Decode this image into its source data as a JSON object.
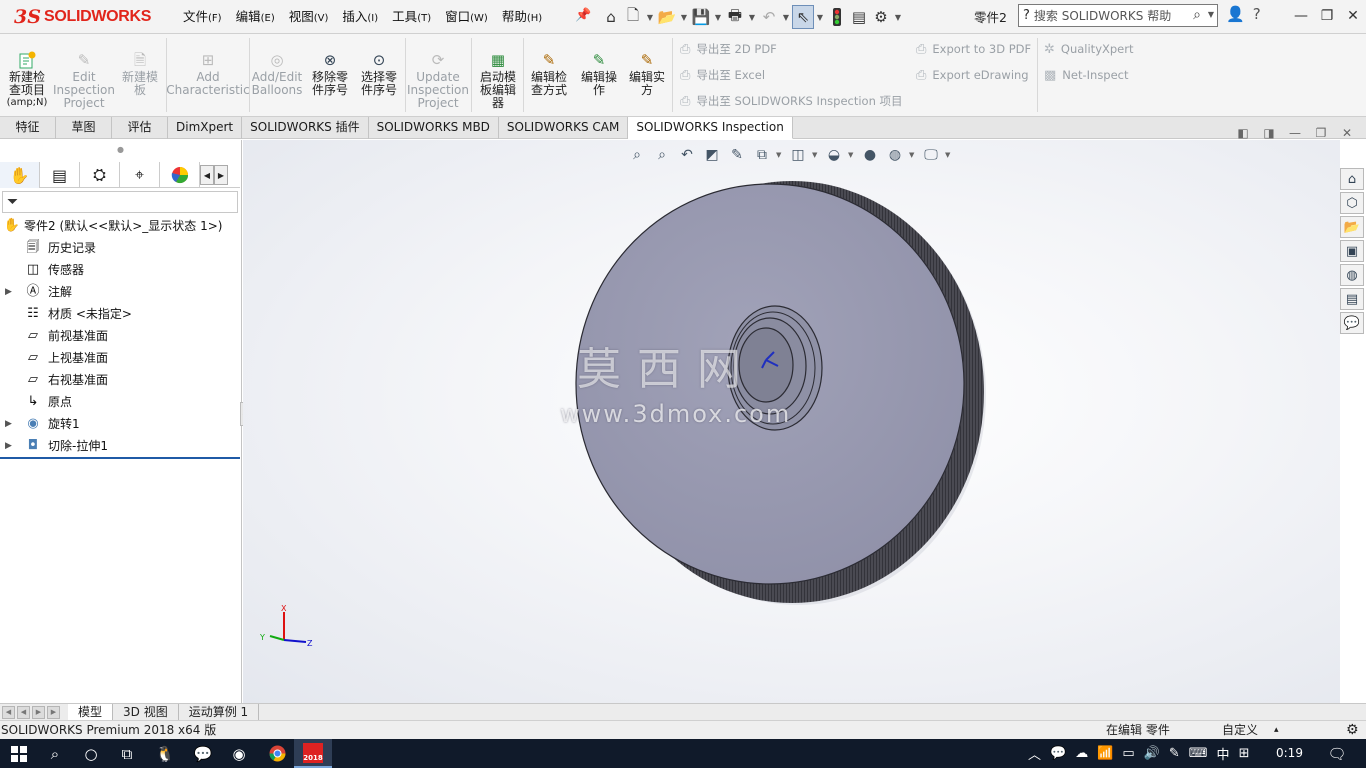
{
  "app": {
    "logo_ds": "3S",
    "logo_text": "SOLIDWORKS",
    "doc_name": "零件2"
  },
  "menu": [
    {
      "label": "文件",
      "key": "(F)"
    },
    {
      "label": "编辑",
      "key": "(E)"
    },
    {
      "label": "视图",
      "key": "(V)"
    },
    {
      "label": "插入",
      "key": "(I)"
    },
    {
      "label": "工具",
      "key": "(T)"
    },
    {
      "label": "窗口",
      "key": "(W)"
    },
    {
      "label": "帮助",
      "key": "(H)"
    }
  ],
  "search": {
    "placeholder": "搜索 SOLIDWORKS 帮助"
  },
  "ribbon": {
    "new_project": {
      "line1": "新建检",
      "line2": "查项目",
      "line3": "(amp;N)"
    },
    "edit_project": {
      "line1": "Edit",
      "line2": "Inspection",
      "line3": "Project"
    },
    "new_template": {
      "line1": "新建模",
      "line2": "板"
    },
    "add_char": {
      "line1": "Add",
      "line2": "Characteristic"
    },
    "add_balloons": {
      "line1": "Add/Edit",
      "line2": "Balloons"
    },
    "remove_part_no": {
      "line1": "移除零",
      "line2": "件序号"
    },
    "select_part_no": {
      "line1": "选择零",
      "line2": "件序号"
    },
    "update_project": {
      "line1": "Update",
      "line2": "Inspection",
      "line3": "Project"
    },
    "launch_template_editor": {
      "line1": "启动模",
      "line2": "板编辑",
      "line3": "器"
    },
    "edit_method": {
      "line1": "编辑检",
      "line2": "查方式"
    },
    "edit_operation": {
      "line1": "编辑操",
      "line2": "作"
    },
    "edit_instance": {
      "line1": "编辑实",
      "line2": "方"
    },
    "export_2d_pdf": "导出至 2D PDF",
    "export_excel": "导出至 Excel",
    "export_sw_project": "导出至 SOLIDWORKS Inspection 项目",
    "export_3d_pdf": "Export to 3D PDF",
    "export_edrawing": "Export eDrawing",
    "qualityxpert": "QualityXpert",
    "net_inspect": "Net-Inspect"
  },
  "tabs": [
    "特征",
    "草图",
    "评估",
    "DimXpert",
    "SOLIDWORKS 插件",
    "SOLIDWORKS MBD",
    "SOLIDWORKS CAM",
    "SOLIDWORKS Inspection"
  ],
  "tree": {
    "root": "零件2  (默认<<默认>_显示状态 1>)",
    "items": [
      "历史记录",
      "传感器",
      "注解",
      "材质 <未指定>",
      "前视基准面",
      "上视基准面",
      "右视基准面",
      "原点",
      "旋转1",
      "切除-拉伸1"
    ]
  },
  "watermark": {
    "cn": "莫西网",
    "url": "www.3dmox.com"
  },
  "triad": {
    "x": "X",
    "y": "Y",
    "z": "Z"
  },
  "bottom_tabs": [
    "模型",
    "3D 视图",
    "运动算例 1"
  ],
  "status": {
    "left": "SOLIDWORKS Premium 2018 x64 版",
    "mid": "在编辑 零件",
    "right": "自定义",
    "caret": "▴"
  },
  "taskbar": {
    "tray_ime": "中",
    "clock": "0:19",
    "sw_badge": "2018"
  }
}
